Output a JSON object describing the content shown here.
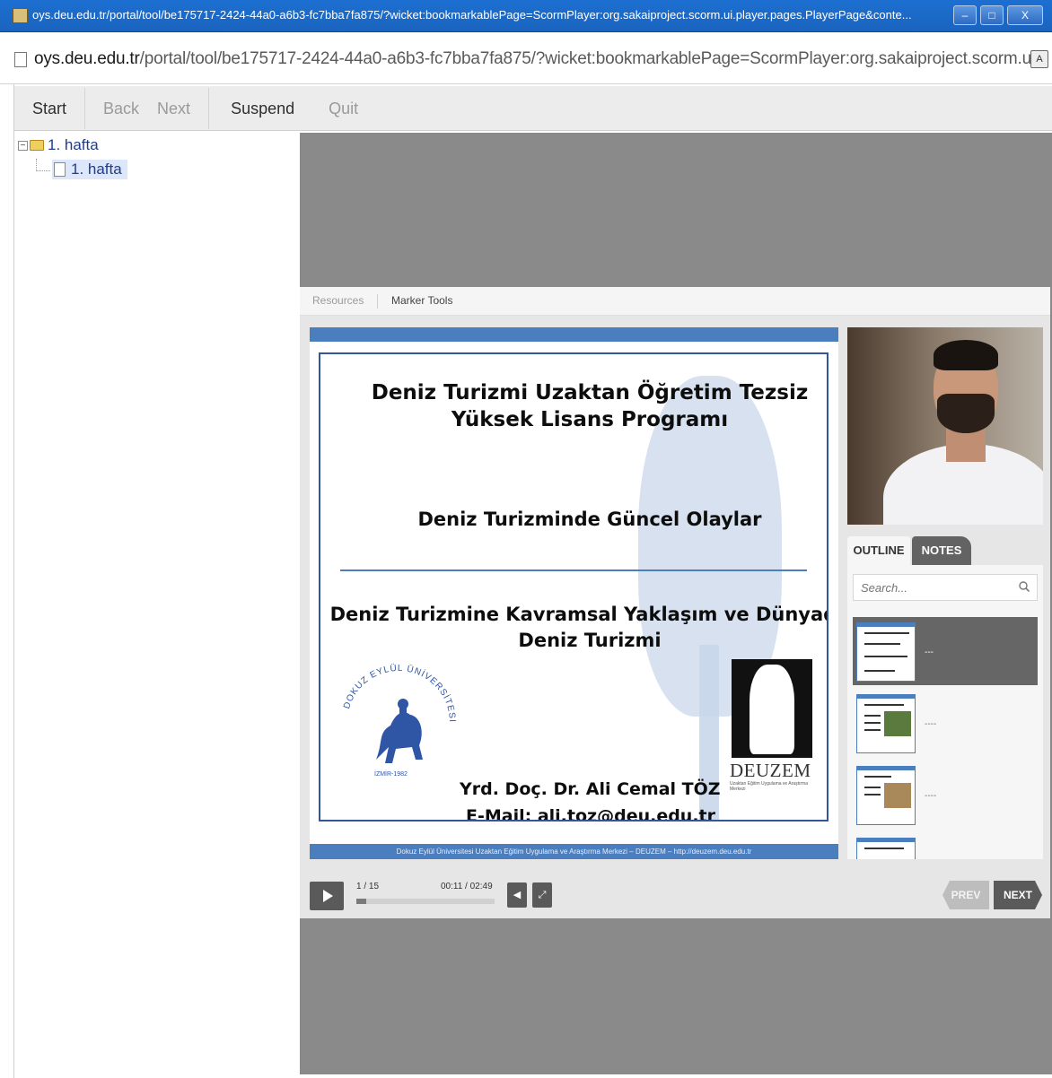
{
  "window": {
    "title": "oys.deu.edu.tr/portal/tool/be175717-2424-44a0-a6b3-fc7bba7fa875/?wicket:bookmarkablePage=ScormPlayer:org.sakaiproject.scorm.ui.player.pages.PlayerPage&conte...",
    "minimize": "–",
    "maximize": "□",
    "close": "X"
  },
  "address_bar": {
    "host": "oys.deu.edu.tr",
    "path": "/portal/tool/be175717-2424-44a0-a6b3-fc7bba7fa875/?wicket:bookmarkablePage=ScormPlayer:org.sakaiproject.scorm.ui.p"
  },
  "toolbar": {
    "start": "Start",
    "back": "Back",
    "next": "Next",
    "suspend": "Suspend",
    "quit": "Quit"
  },
  "tree": {
    "folder": "1. hafta",
    "item": "1. hafta"
  },
  "player_tabs": {
    "resources": "Resources",
    "marker_tools": "Marker Tools"
  },
  "slide": {
    "title": "Deniz Turizmi Uzaktan Öğretim Tezsiz Yüksek Lisans Programı",
    "course": "Deniz Turizminde Güncel Olaylar",
    "topic": "Deniz Turizmine Kavramsal Yaklaşım ve Dünyada Deniz Turizmi",
    "seal_text": "DOKUZ EYLÜL ÜNİVERSİTESİ İZMİR-1982",
    "logo_label": "DEUZEM",
    "logo_sub": "Uzaktan Eğitim Uygulama ve Araştırma Merkezi",
    "author": "Yrd. Doç. Dr. Ali Cemal TÖZ",
    "email": "E-Mail: ali.toz@deu.edu.tr",
    "footer": "Dokuz Eylül Üniversitesi Uzaktan Eğitim Uygulama ve Araştırma Merkezi – DEUZEM – http://deuzem.deu.edu.tr"
  },
  "side_panel": {
    "tab_outline": "OUTLINE",
    "tab_notes": "NOTES",
    "search_placeholder": "Search...",
    "thumbs": [
      {
        "label": "---"
      },
      {
        "label": "----"
      },
      {
        "label": "----"
      }
    ]
  },
  "controls": {
    "slide_count": "1 / 15",
    "time": "00:11 / 02:49",
    "progress": 0.07,
    "prev": "PREV",
    "next": "NEXT"
  },
  "colors": {
    "title_bar": "#1c6fd1",
    "slide_accent": "#4a7ebf",
    "player_bg": "#8a8a8a"
  }
}
